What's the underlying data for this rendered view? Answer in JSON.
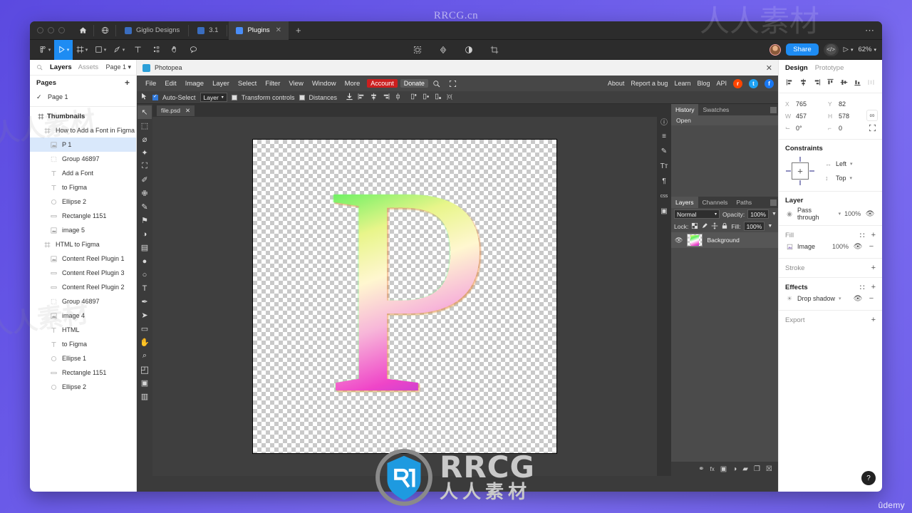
{
  "watermarks": {
    "top": "RRCG.cn",
    "brand": "RRCG",
    "brand_cn": "人人素材",
    "corner": "ûdemy",
    "tile_text": "人人素材"
  },
  "figma": {
    "tabs": [
      {
        "label": "Giglio Designs",
        "active": false,
        "closable": false
      },
      {
        "label": "3.1",
        "active": false,
        "closable": false
      },
      {
        "label": "Plugins",
        "active": true,
        "closable": true
      }
    ],
    "new_tab_label": "+",
    "menu_dots": "⋯",
    "toolbar": {
      "menu_icon": "figma-menu",
      "tools": [
        "move-tool",
        "frame-tool",
        "shape-tool",
        "pen-tool",
        "text-tool",
        "component-tool",
        "hand-tool",
        "comment-tool"
      ],
      "center_tools": [
        "mask-icon",
        "boolean-icon",
        "contrast-icon",
        "crop-icon"
      ],
      "share_label": "Share",
      "code_label": "</>",
      "play_label": "▷",
      "zoom_label": "62%"
    },
    "left_panel": {
      "search_icon": "search-icon",
      "tab_layers": "Layers",
      "tab_assets": "Assets",
      "page_selector": "Page 1",
      "pages_title": "Pages",
      "pages": [
        {
          "label": "Page 1",
          "checked": true
        }
      ],
      "layers_section": "Thumbnails",
      "layers": [
        {
          "label": "How to Add a Font in Figma",
          "icon": "frame-icon",
          "indent": 1,
          "selected": false
        },
        {
          "label": "P 1",
          "icon": "image-icon",
          "indent": 2,
          "selected": true
        },
        {
          "label": "Group 46897",
          "icon": "group-icon",
          "indent": 2,
          "selected": false
        },
        {
          "label": "Add a Font",
          "icon": "text-icon",
          "indent": 2,
          "selected": false
        },
        {
          "label": "to Figma",
          "icon": "text-icon",
          "indent": 2,
          "selected": false
        },
        {
          "label": "Ellipse 2",
          "icon": "ellipse-icon",
          "indent": 2,
          "selected": false
        },
        {
          "label": "Rectangle 1151",
          "icon": "rectangle-icon",
          "indent": 2,
          "selected": false
        },
        {
          "label": "image 5",
          "icon": "image-icon",
          "indent": 2,
          "selected": false
        },
        {
          "label": "HTML to Figma",
          "icon": "frame-icon",
          "indent": 1,
          "selected": false
        },
        {
          "label": "Content Reel Plugin 1",
          "icon": "image-icon",
          "indent": 2,
          "selected": false
        },
        {
          "label": "Content Reel Plugin 3",
          "icon": "rectangle-icon",
          "indent": 2,
          "selected": false
        },
        {
          "label": "Content Reel Plugin 2",
          "icon": "rectangle-icon",
          "indent": 2,
          "selected": false
        },
        {
          "label": "Group 46897",
          "icon": "group-icon",
          "indent": 2,
          "selected": false
        },
        {
          "label": "image 4",
          "icon": "image-icon",
          "indent": 2,
          "selected": false
        },
        {
          "label": "HTML",
          "icon": "text-icon",
          "indent": 2,
          "selected": false
        },
        {
          "label": "to Figma",
          "icon": "text-icon",
          "indent": 2,
          "selected": false
        },
        {
          "label": "Ellipse 1",
          "icon": "ellipse-icon",
          "indent": 2,
          "selected": false
        },
        {
          "label": "Rectangle 1151",
          "icon": "rectangle-icon",
          "indent": 2,
          "selected": false
        },
        {
          "label": "Ellipse 2",
          "icon": "ellipse-icon",
          "indent": 2,
          "selected": false
        }
      ]
    },
    "right_panel": {
      "tab_design": "Design",
      "tab_prototype": "Prototype",
      "x_key": "X",
      "x_val": "765",
      "y_key": "Y",
      "y_val": "82",
      "w_key": "W",
      "w_val": "457",
      "h_key": "H",
      "h_val": "578",
      "rot_key": "⌙",
      "rot_val": "0°",
      "corner_key": "⌐",
      "corner_val": "0",
      "constraints_title": "Constraints",
      "constraint_h": "Left",
      "constraint_v": "Top",
      "layer_title": "Layer",
      "layer_blend": "Pass through",
      "layer_opacity": "100%",
      "fill_title": "Fill",
      "fill_type": "Image",
      "fill_opacity": "100%",
      "stroke_title": "Stroke",
      "effects_title": "Effects",
      "effect_name": "Drop shadow",
      "export_title": "Export",
      "help_label": "?"
    }
  },
  "photopea": {
    "window_title": "Photopea",
    "close_label": "✕",
    "menu": [
      "File",
      "Edit",
      "Image",
      "Layer",
      "Select",
      "Filter",
      "View",
      "Window",
      "More"
    ],
    "account_label": "Account",
    "donate_label": "Donate",
    "search_icon": "search-icon",
    "fullscreen_icon": "fullscreen-icon",
    "menu_right": [
      "About",
      "Report a bug",
      "Learn",
      "Blog",
      "API"
    ],
    "social": [
      "reddit-icon",
      "twitter-icon",
      "facebook-icon"
    ],
    "options": {
      "move_tool_icon": "move-tool-icon",
      "auto_select_label": "Auto-Select",
      "auto_select_checked": true,
      "target_select": "Layer",
      "transform_controls_label": "Transform controls",
      "transform_controls_checked": false,
      "distances_label": "Distances",
      "distances_checked": false
    },
    "document_tab": "file.psd",
    "document_tab_close": "✕",
    "tools": [
      "move-tool",
      "marquee-tool",
      "lasso-tool",
      "magic-wand-tool",
      "crop-tool",
      "eyedropper-tool",
      "healing-brush-tool",
      "brush-tool",
      "stamp-tool",
      "history-brush-tool",
      "gradient-tool",
      "blur-tool",
      "dodge-tool",
      "type-tool",
      "pen-tool",
      "path-select-tool",
      "shape-tool",
      "hand-tool",
      "zoom-tool",
      "color-swatches",
      "quick-mask",
      "screen-mode"
    ],
    "right_strip": [
      "info-icon",
      "adjustments-icon",
      "brush-panel-icon",
      "character-icon",
      "paragraph-icon",
      "css-icon",
      "image-panel-icon"
    ],
    "history_panel": {
      "tab_history": "History",
      "tab_swatches": "Swatches",
      "items": [
        "Open"
      ]
    },
    "layers_panel": {
      "tab_layers": "Layers",
      "tab_channels": "Channels",
      "tab_paths": "Paths",
      "blend_mode": "Normal",
      "opacity_label": "Opacity:",
      "opacity_value": "100%",
      "lock_label": "Lock:",
      "fill_label": "Fill:",
      "fill_value": "100%",
      "layers": [
        {
          "name": "Background",
          "visible": true
        }
      ]
    },
    "status_icons": [
      "link-icon",
      "fx-icon",
      "mask-icon",
      "adjustment-icon",
      "folder-icon",
      "new-layer-icon",
      "trash-icon"
    ],
    "canvas": {
      "letter": "P",
      "alt": "glossy iridescent letter P on transparent background"
    }
  },
  "colors": {
    "figma_blue": "#1e8cf3",
    "photopea_red": "#cc1f1f",
    "selection_blue": "#d9e8fb",
    "desktop_purple": "#6a5ae8"
  }
}
